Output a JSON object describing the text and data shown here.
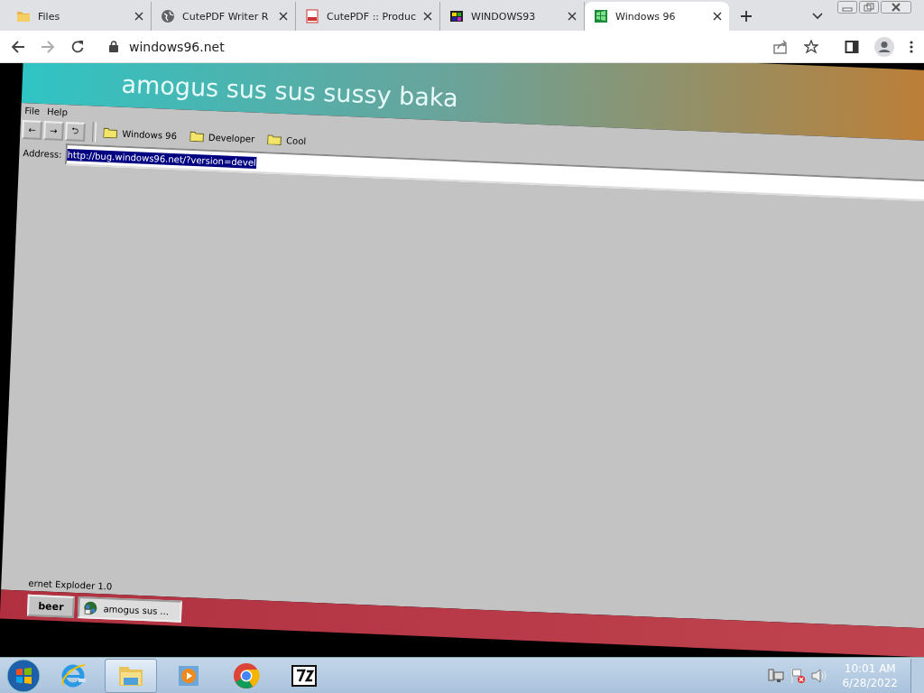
{
  "browser": {
    "tabs": [
      {
        "title": "Files",
        "kind": "folder",
        "selected": false
      },
      {
        "title": "CutePDF Writer R",
        "kind": "globe",
        "selected": false
      },
      {
        "title": "CutePDF :: Produc",
        "kind": "document",
        "selected": false
      },
      {
        "title": "WINDOWS93",
        "kind": "tiles",
        "selected": false
      },
      {
        "title": "Windows 96",
        "kind": "logo",
        "selected": true
      }
    ],
    "address": "windows96.net"
  },
  "page": {
    "title": "amogus sus sus sussy baka",
    "menu": [
      "File",
      "Help"
    ],
    "nav_buttons": [
      "←",
      "→",
      "⮌"
    ],
    "bookmarks": [
      "Windows 96",
      "Developer",
      "Cool"
    ],
    "address_label": "Address:",
    "address_value": "http://bug.windows96.net/?version=devel",
    "status_text": "ernet Exploder 1.0",
    "start_button": "beer",
    "tasks": [
      {
        "label": "amogus sus ...",
        "selected": true
      }
    ]
  },
  "taskbar": {
    "apps": [
      {
        "kind": "ie",
        "active": false
      },
      {
        "kind": "explorer",
        "active": true
      },
      {
        "kind": "media",
        "active": false
      },
      {
        "kind": "chrome",
        "active": false
      },
      {
        "kind": "archive",
        "active": false
      }
    ],
    "time": "10:01 AM",
    "date": "6/28/2022"
  }
}
